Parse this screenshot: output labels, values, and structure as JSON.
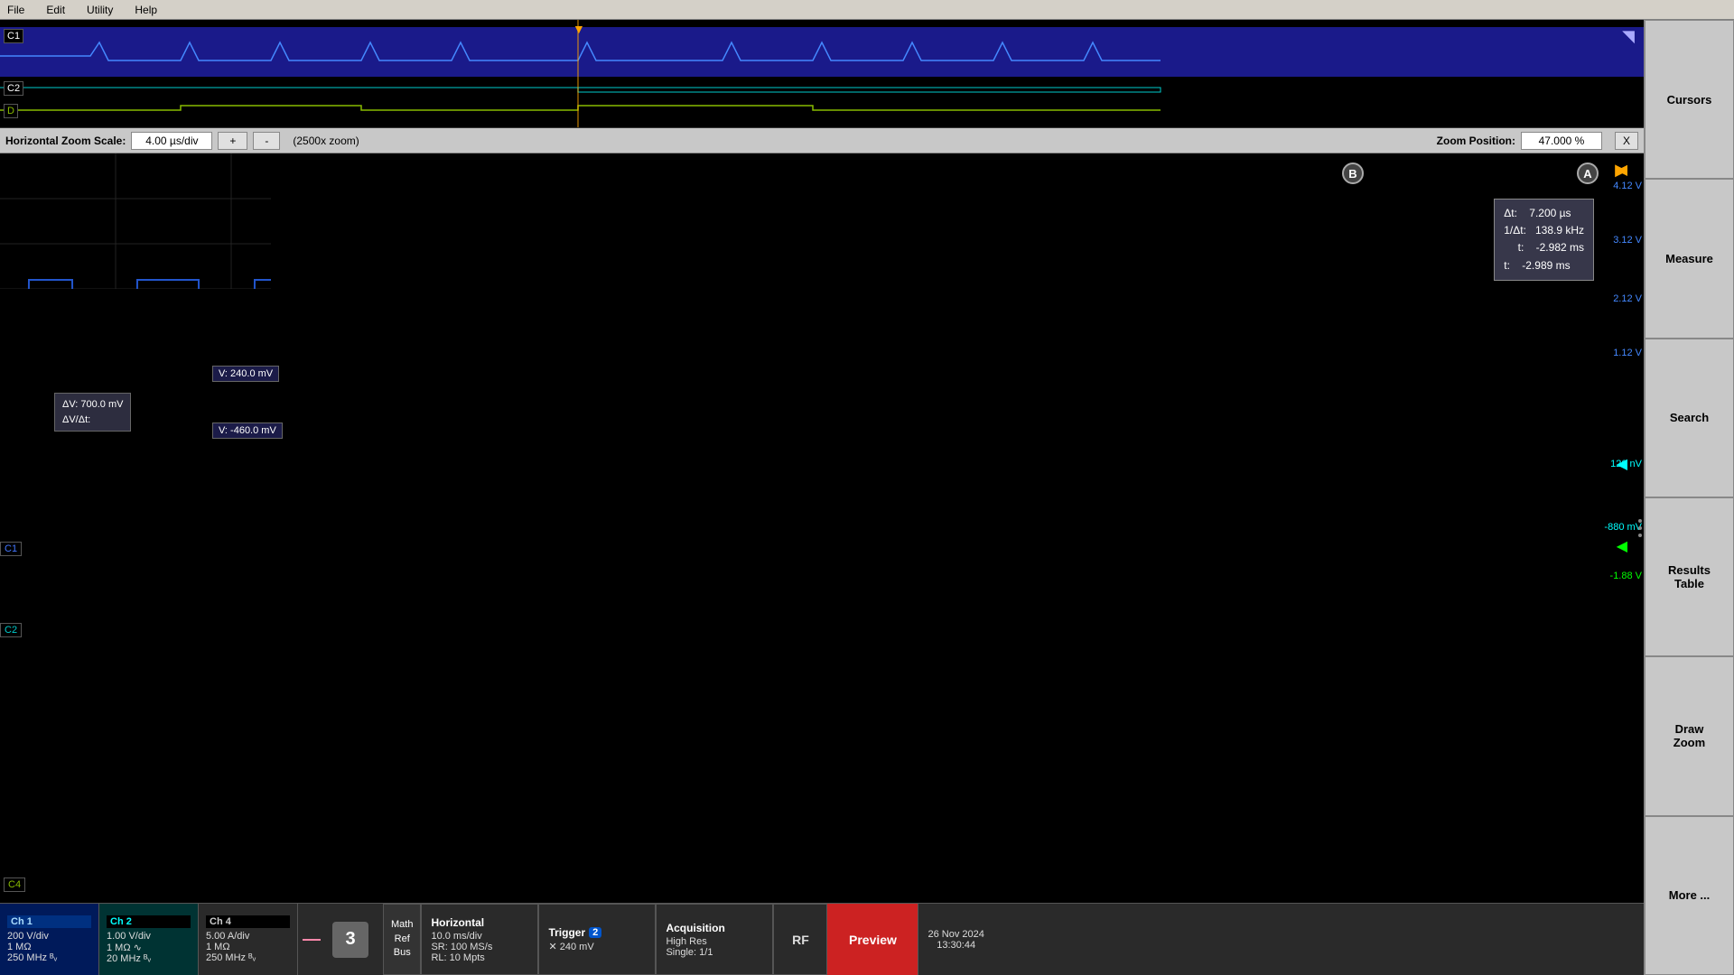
{
  "menubar": {
    "items": [
      "File",
      "Edit",
      "Utility",
      "Help"
    ]
  },
  "overview": {
    "ch1_label": "C1",
    "ch2_label": "C2",
    "ch4_label": "D",
    "trigger_position": "640px"
  },
  "zoom_bar": {
    "horizontal_zoom_scale_label": "Horizontal Zoom Scale:",
    "zoom_value": "4.00 µs/div",
    "plus_btn": "+",
    "minus_btn": "-",
    "zoom_info": "(2500x zoom)",
    "zoom_position_label": "Zoom Position:",
    "zoom_position_value": "47.000 %",
    "close_btn": "X"
  },
  "waveform": {
    "cursor_a_label": "A",
    "cursor_b_label": "B",
    "readout": {
      "delta_t_label": "Δt:",
      "delta_t_value": "7.200 µs",
      "inv_delta_t_label": "1/Δt:",
      "inv_delta_t_value": "138.9 kHz",
      "t_a_label": "t:",
      "t_a_value": "-2.982 ms",
      "t_b_label": "t:",
      "t_b_value": "-2.989 ms"
    },
    "voltage_labels": {
      "v1": "4.12 V",
      "v2": "3.12 V",
      "v3": "2.12 V",
      "v4": "1.12 V",
      "v5": "120 nV",
      "v6": "-880 mV",
      "v7": "-1.88 V"
    },
    "ch1_label": "C1",
    "ch2_label": "C2",
    "c2_measurement": {
      "delta_v": "ΔV:     700.0 mV",
      "delta_v_dt": "ΔV/Δt:",
      "v_top": "V:  240.0 mV",
      "v_bot": "V: -460.0 mV"
    }
  },
  "status_bar": {
    "ch1": {
      "title": "Ch 1",
      "line1": "200 V/div",
      "line2": "1 MΩ",
      "line3": "250 MHz  ᴮᵥ"
    },
    "ch2": {
      "title": "Ch 2",
      "line1": "1.00 V/div",
      "line2": "1 MΩ  ∿",
      "line3": "20 MHz  ᴮᵥ"
    },
    "ch4": {
      "title": "Ch 4",
      "line1": "5.00 A/div",
      "line2": "1 MΩ",
      "line3": "250 MHz  ᴮᵥ"
    },
    "num": "3",
    "math_ref_bus": "Math\nRef\nBus",
    "horizontal": {
      "title": "Horizontal",
      "line1": "10.0 ms/div",
      "line2": "SR: 100 MS/s",
      "line3": "RL: 10 Mpts"
    },
    "trigger": {
      "title": "Trigger",
      "badge": "2",
      "line1": "✕   240 mV"
    },
    "acquisition": {
      "title": "Acquisition",
      "line1": "High Res",
      "line2": "Single: 1/1"
    },
    "rf": "RF",
    "preview": "Preview",
    "datetime": {
      "date": "26 Nov 2024",
      "time": "13:30:44"
    }
  },
  "right_panel": {
    "cursors_btn": "Cursors",
    "measure_btn": "Measure",
    "search_btn": "Search",
    "results_table_btn": "Results\nTable",
    "draw_zoom_btn": "Draw\nZoom",
    "more_btn": "More ..."
  }
}
